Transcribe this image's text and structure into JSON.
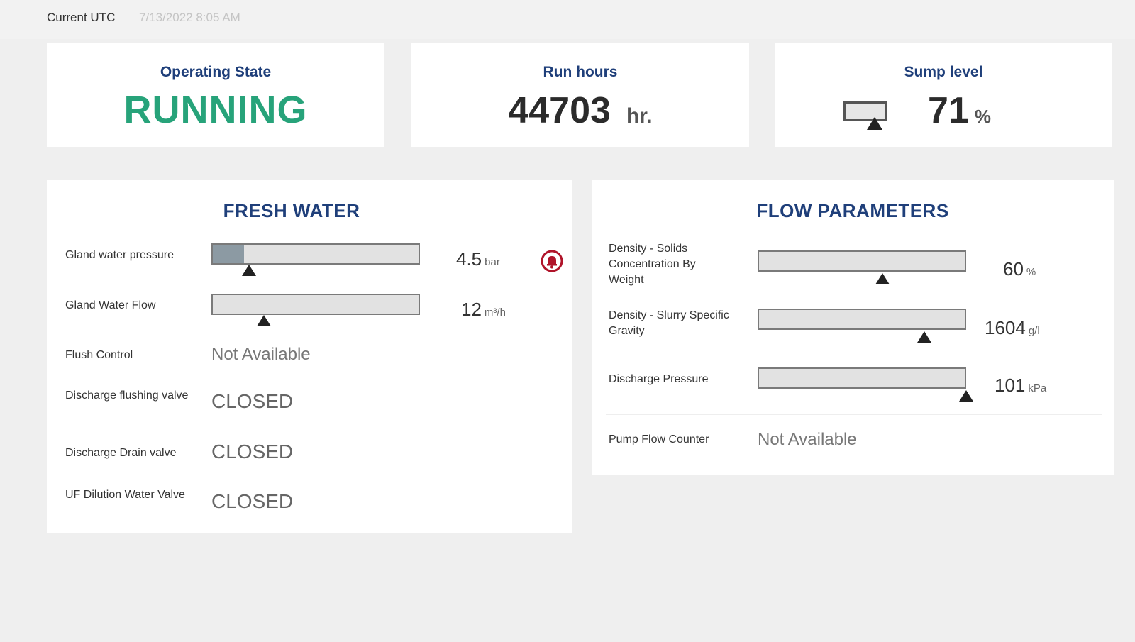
{
  "header": {
    "utc_label": "Current UTC",
    "utc_value": "7/13/2022 8:05 AM"
  },
  "kpis": {
    "operating_state": {
      "title": "Operating State",
      "value": "RUNNING",
      "color": "#27a37a"
    },
    "run_hours": {
      "title": "Run hours",
      "value": "44703",
      "unit": "hr."
    },
    "sump_level": {
      "title": "Sump level",
      "value": "71",
      "unit": "%",
      "level_fraction": 0.71
    }
  },
  "fresh_water": {
    "title": "FRESH WATER",
    "rows": [
      {
        "label": "Gland water pressure",
        "kind": "gauge",
        "value": "4.5",
        "unit": "bar",
        "fill_fraction": 0.15,
        "pointer_fraction": 0.18,
        "alarm": true,
        "alarm_icon": "alarm-bell-icon"
      },
      {
        "label": "Gland Water Flow",
        "kind": "gauge",
        "value": "12",
        "unit": "m³/h",
        "fill_fraction": 0.0,
        "pointer_fraction": 0.25,
        "alarm": false
      },
      {
        "label": "Flush Control",
        "kind": "na",
        "value": "Not Available"
      },
      {
        "label": "Discharge flushing valve",
        "kind": "status",
        "value": "CLOSED"
      },
      {
        "label": "Discharge Drain valve",
        "kind": "status",
        "value": "CLOSED"
      },
      {
        "label": "UF Dilution Water Valve",
        "kind": "status",
        "value": "CLOSED"
      }
    ]
  },
  "flow_parameters": {
    "title": "FLOW PARAMETERS",
    "rows": [
      {
        "label": "Density - Solids Concentration By Weight",
        "kind": "gauge",
        "value": "60",
        "unit": "%",
        "pointer_fraction": 0.6
      },
      {
        "label": "Density - Slurry Specific Gravity",
        "kind": "gauge",
        "value": "1604",
        "unit": "g/l",
        "pointer_fraction": 0.8
      },
      {
        "label": "Discharge Pressure",
        "kind": "gauge",
        "value": "101",
        "unit": "kPa",
        "pointer_fraction": 1.0
      },
      {
        "label": "Pump Flow Counter",
        "kind": "na",
        "value": "Not Available"
      }
    ]
  }
}
